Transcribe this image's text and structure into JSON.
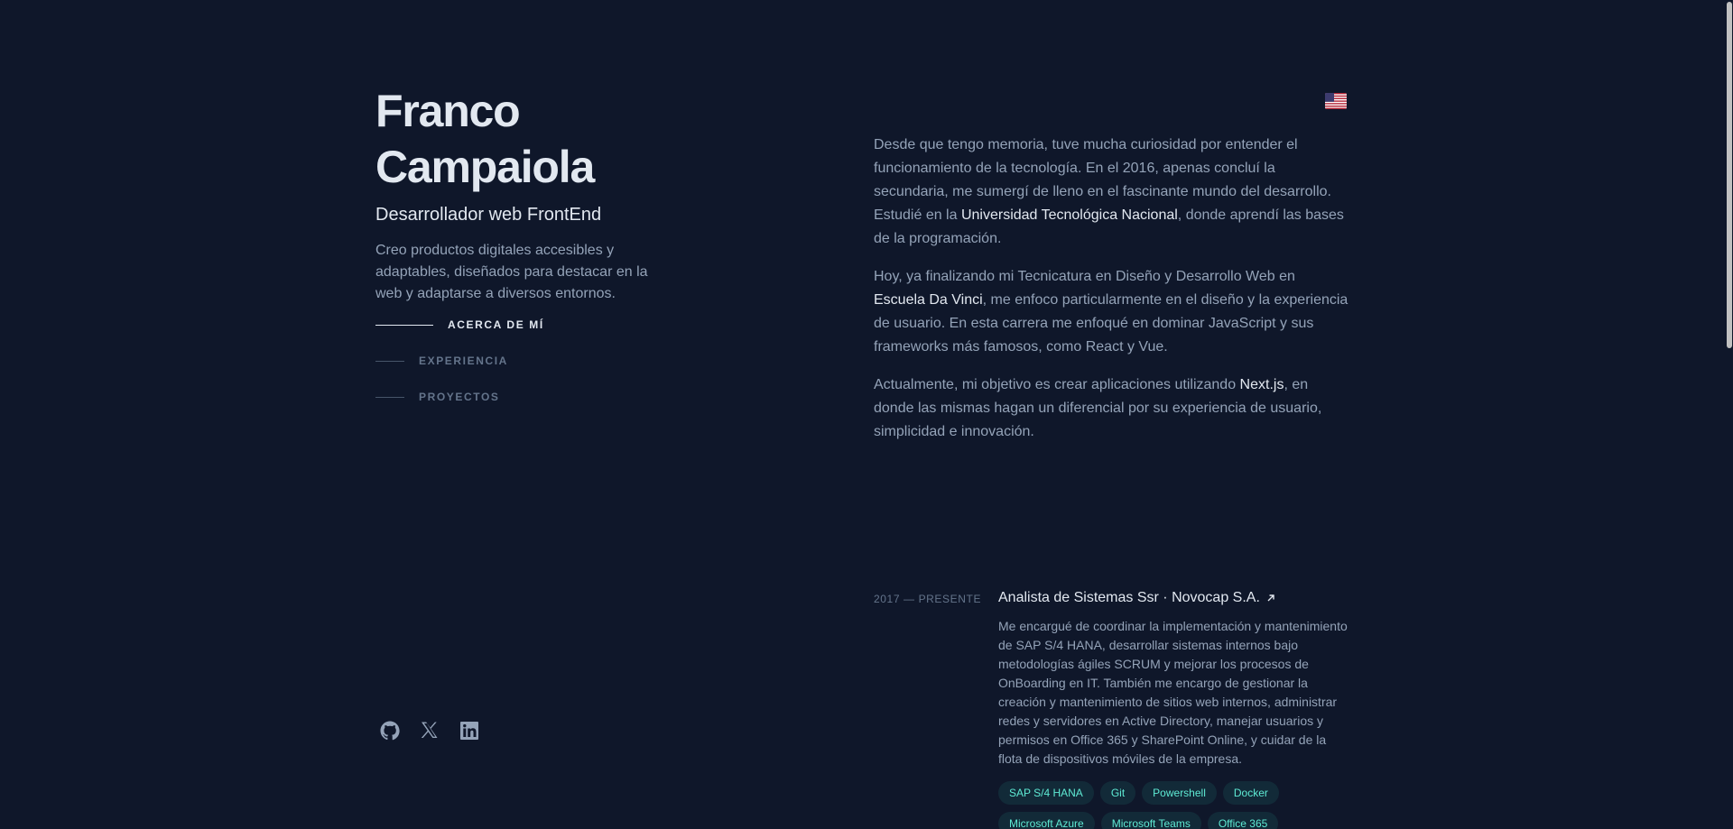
{
  "header": {
    "name": "Franco Campaiola",
    "role": "Desarrollador web FrontEnd",
    "bio": "Creo productos digitales accesibles y adaptables, diseñados para destacar en la web y adaptarse a diversos entornos."
  },
  "nav": {
    "items": [
      {
        "label": "ACERCA DE MÍ",
        "active": true
      },
      {
        "label": "EXPERIENCIA",
        "active": false
      },
      {
        "label": "PROYECTOS",
        "active": false
      }
    ]
  },
  "language_flag": "us-flag-icon",
  "about": {
    "p1_a": "Desde que tengo memoria, tuve mucha curiosidad por entender el funcionamiento de la tecnología. En el 2016, apenas concluí la secundaria, me sumergí de lleno en el fascinante mundo del desarrollo. Estudié en la ",
    "p1_hl": "Universidad Tecnológica Nacional",
    "p1_b": ", donde aprendí las bases de la programación.",
    "p2_a": "Hoy, ya finalizando mi Tecnicatura en Diseño y Desarrollo Web en ",
    "p2_hl": "Escuela Da Vinci",
    "p2_b": ", me enfoco particularmente en el diseño y la experiencia de usuario. En esta carrera me enfoqué en dominar JavaScript y sus frameworks más famosos, como React y Vue.",
    "p3_a": "Actualmente, mi objetivo es crear aplicaciones utilizando ",
    "p3_hl": "Next.js",
    "p3_b": ", en donde las mismas hagan un diferencial por su experiencia de usuario, simplicidad e innovación."
  },
  "experience": [
    {
      "date": "2017 — PRESENTE",
      "title": "Analista de Sistemas Ssr · Novocap S.A.",
      "description": "Me encargué de coordinar la implementación y mantenimiento de SAP S/4 HANA, desarrollar sistemas internos bajo metodologías ágiles SCRUM y mejorar los procesos de OnBoarding en IT. También me encargo de gestionar la creación y mantenimiento de sitios web internos, administrar redes y servidores en Active Directory, manejar usuarios y permisos en Office 365 y SharePoint Online, y cuidar de la flota de dispositivos móviles de la empresa.",
      "tags": [
        "SAP S/4 HANA",
        "Git",
        "Powershell",
        "Docker",
        "Microsoft Azure",
        "Microsoft Teams",
        "Office 365"
      ]
    }
  ],
  "socials": [
    "github-icon",
    "x-icon",
    "linkedin-icon"
  ],
  "colors": {
    "background": "#0f172a",
    "heading": "#e2e8f0",
    "text": "#94a3b8",
    "accent": "#5eead4"
  }
}
